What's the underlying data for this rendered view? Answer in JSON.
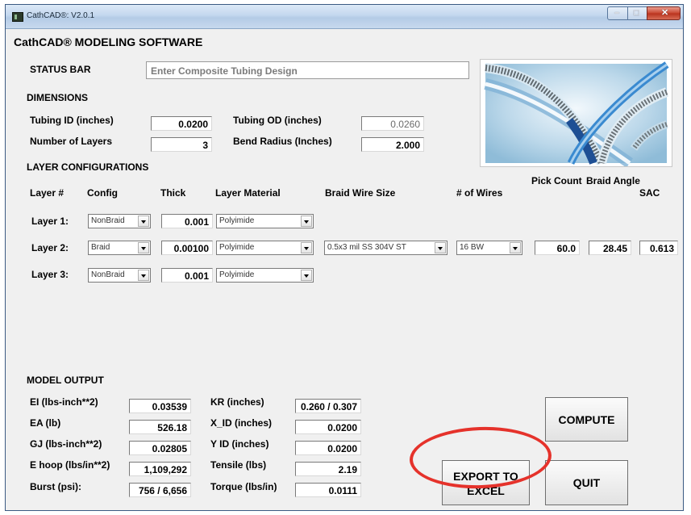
{
  "window": {
    "title": "CathCAD®: V2.0.1"
  },
  "app_title": "CathCAD® MODELING SOFTWARE",
  "status": {
    "label": "STATUS BAR",
    "value": "Enter Composite Tubing Design"
  },
  "dimensions": {
    "heading": "DIMENSIONS",
    "tubing_id_label": "Tubing ID (inches)",
    "tubing_id_value": "0.0200",
    "tubing_od_label": "Tubing OD (inches)",
    "tubing_od_value": "0.0260",
    "layers_label": "Number of Layers",
    "layers_value": "3",
    "bend_label": "Bend Radius (Inches)",
    "bend_value": "2.000"
  },
  "layers": {
    "heading": "LAYER CONFIGURATIONS",
    "columns": {
      "layer": "Layer #",
      "config": "Config",
      "thick": "Thick",
      "material": "Layer Material",
      "wire": "Braid Wire Size",
      "wires": "# of Wires",
      "pick": "Pick Count",
      "angle": "Braid Angle",
      "sac": "SAC"
    },
    "rows": [
      {
        "label": "Layer 1:",
        "config": "NonBraid",
        "thick": "0.001",
        "material": "Polyimide"
      },
      {
        "label": "Layer 2:",
        "config": "Braid",
        "thick": "0.00100",
        "material": "Polyimide",
        "wire": "0.5x3 mil SS 304V ST",
        "wires": "16 BW",
        "pick": "60.0",
        "angle": "28.45",
        "sac": "0.613"
      },
      {
        "label": "Layer 3:",
        "config": "NonBraid",
        "thick": "0.001",
        "material": "Polyimide"
      }
    ]
  },
  "output": {
    "heading": "MODEL OUTPUT",
    "ei_label": "EI (lbs-inch**2)",
    "ei_value": "0.03539",
    "ea_label": "EA (lb)",
    "ea_value": "526.18",
    "gj_label": "GJ (lbs-inch**2)",
    "gj_value": "0.02805",
    "ehoop_label": "E hoop (lbs/in**2)",
    "ehoop_value": "1,109,292",
    "burst_label": "Burst (psi):",
    "burst_value": "756 / 6,656",
    "kr_label": "KR (inches)",
    "kr_value": "0.260 / 0.307",
    "xid_label": "X_ID (inches)",
    "xid_value": "0.0200",
    "yid_label": "Y ID (inches)",
    "yid_value": "0.0200",
    "tensile_label": "Tensile (lbs)",
    "tensile_value": "2.19",
    "torque_label": "Torque (lbs/in)",
    "torque_value": "0.0111"
  },
  "buttons": {
    "compute": "COMPUTE",
    "export_line1": "EXPORT TO",
    "export_line2": "EXCEL",
    "quit": "QUIT"
  },
  "icons": {
    "app": "app-icon",
    "minimize": "minimize-icon",
    "maximize": "maximize-icon",
    "close": "close-icon"
  },
  "colors": {
    "highlight_ring": "#e5322b",
    "titlebar": "#c3d7ee",
    "close_button": "#c8452f"
  }
}
